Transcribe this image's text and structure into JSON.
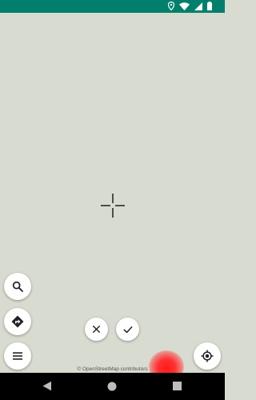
{
  "status_bar": {
    "background": "#00806c"
  },
  "map": {
    "background": "#d8dbcf",
    "attribution": "© OpenStreetMap contributors"
  },
  "buttons": {
    "search": "search-icon",
    "directions": "directions-icon",
    "menu": "menu-icon",
    "cancel": "close-icon",
    "confirm": "check-icon",
    "my_location": "my-location-icon"
  },
  "nav_bar": {
    "back": "back-icon",
    "home": "home-icon",
    "recents": "recents-icon"
  }
}
